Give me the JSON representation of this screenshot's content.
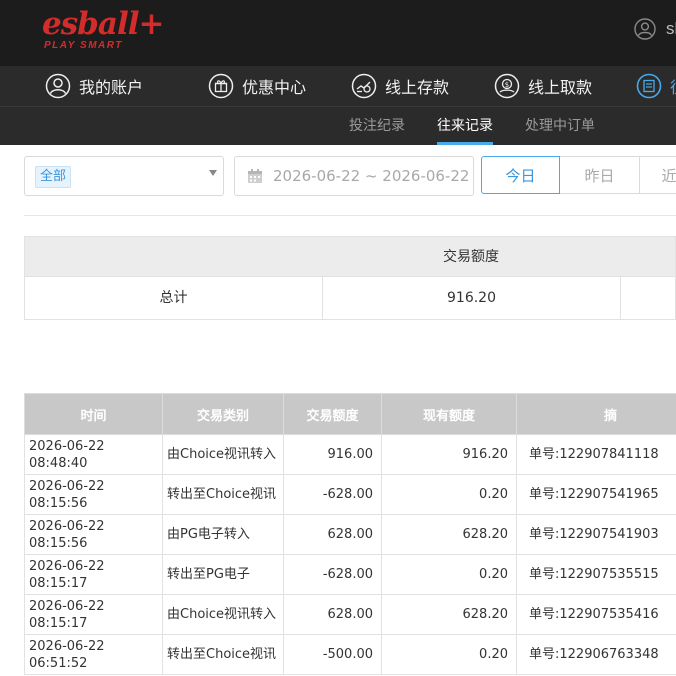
{
  "header": {
    "logo_main": "esball",
    "logo_plus": "+",
    "logo_sub": "PLAY SMART",
    "user_name": "sl"
  },
  "nav": {
    "items": [
      {
        "label": "我的账户",
        "icon": "user-circle-icon"
      },
      {
        "label": "优惠中心",
        "icon": "gift-icon"
      },
      {
        "label": "线上存款",
        "icon": "deposit-icon"
      },
      {
        "label": "线上取款",
        "icon": "withdraw-icon"
      },
      {
        "label": "往",
        "icon": "records-icon"
      }
    ]
  },
  "subnav": {
    "tabs": [
      {
        "label": "投注纪录",
        "active": false
      },
      {
        "label": "往来记录",
        "active": true
      },
      {
        "label": "处理中订单",
        "active": false
      }
    ]
  },
  "filters": {
    "type_selected": "全部",
    "date_range": "2026-06-22 ~ 2026-06-22",
    "quick": [
      "今日",
      "昨日",
      "近"
    ],
    "quick_active": "今日"
  },
  "summary": {
    "header": "交易额度",
    "row_label": "总计",
    "row_value": "916.20"
  },
  "records": {
    "columns": [
      "时间",
      "交易类别",
      "交易额度",
      "现有额度",
      "摘"
    ],
    "rows": [
      {
        "time": "2026-06-22 08:48:40",
        "type": "由Choice视讯转入",
        "amount": "916.00",
        "balance": "916.20",
        "ref": "单号:122907841118"
      },
      {
        "time": "2026-06-22 08:15:56",
        "type": "转出至Choice视讯",
        "amount": "-628.00",
        "balance": "0.20",
        "ref": "单号:122907541965"
      },
      {
        "time": "2026-06-22 08:15:56",
        "type": "由PG电子转入",
        "amount": "628.00",
        "balance": "628.20",
        "ref": "单号:122907541903"
      },
      {
        "time": "2026-06-22 08:15:17",
        "type": "转出至PG电子",
        "amount": "-628.00",
        "balance": "0.20",
        "ref": "单号:122907535515"
      },
      {
        "time": "2026-06-22 08:15:17",
        "type": "由Choice视讯转入",
        "amount": "628.00",
        "balance": "628.20",
        "ref": "单号:122907535416"
      },
      {
        "time": "2026-06-22 06:51:52",
        "type": "转出至Choice视讯",
        "amount": "-500.00",
        "balance": "0.20",
        "ref": "单号:122906763348"
      }
    ]
  },
  "colors": {
    "brand_red": "#d42b2b",
    "accent_blue": "#4aa9e9",
    "topbar_bg": "#1c1c1c",
    "nav_bg": "#2b2b2b",
    "table_head_bg": "#c8c8c8"
  }
}
